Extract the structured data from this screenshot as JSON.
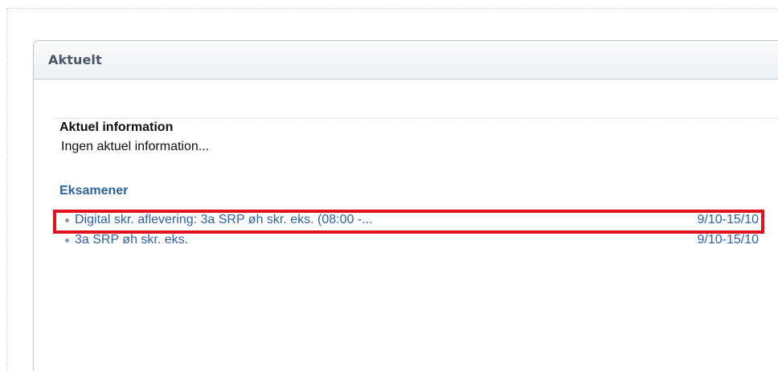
{
  "panel": {
    "title": "Aktuelt"
  },
  "information": {
    "heading": "Aktuel information",
    "text": "Ingen aktuel information..."
  },
  "exams": {
    "heading": "Eksamener",
    "items": [
      {
        "title": "Digital skr. aflevering: 3a SRP øh skr. eks. (08:00 -...",
        "date": "9/10-15/10",
        "highlighted": true
      },
      {
        "title": "3a SRP øh skr. eks.",
        "date": "9/10-15/10",
        "highlighted": false
      }
    ]
  },
  "colors": {
    "link": "#2f62a0",
    "highlight_border": "#e1141d",
    "header_text": "#4a5866"
  }
}
